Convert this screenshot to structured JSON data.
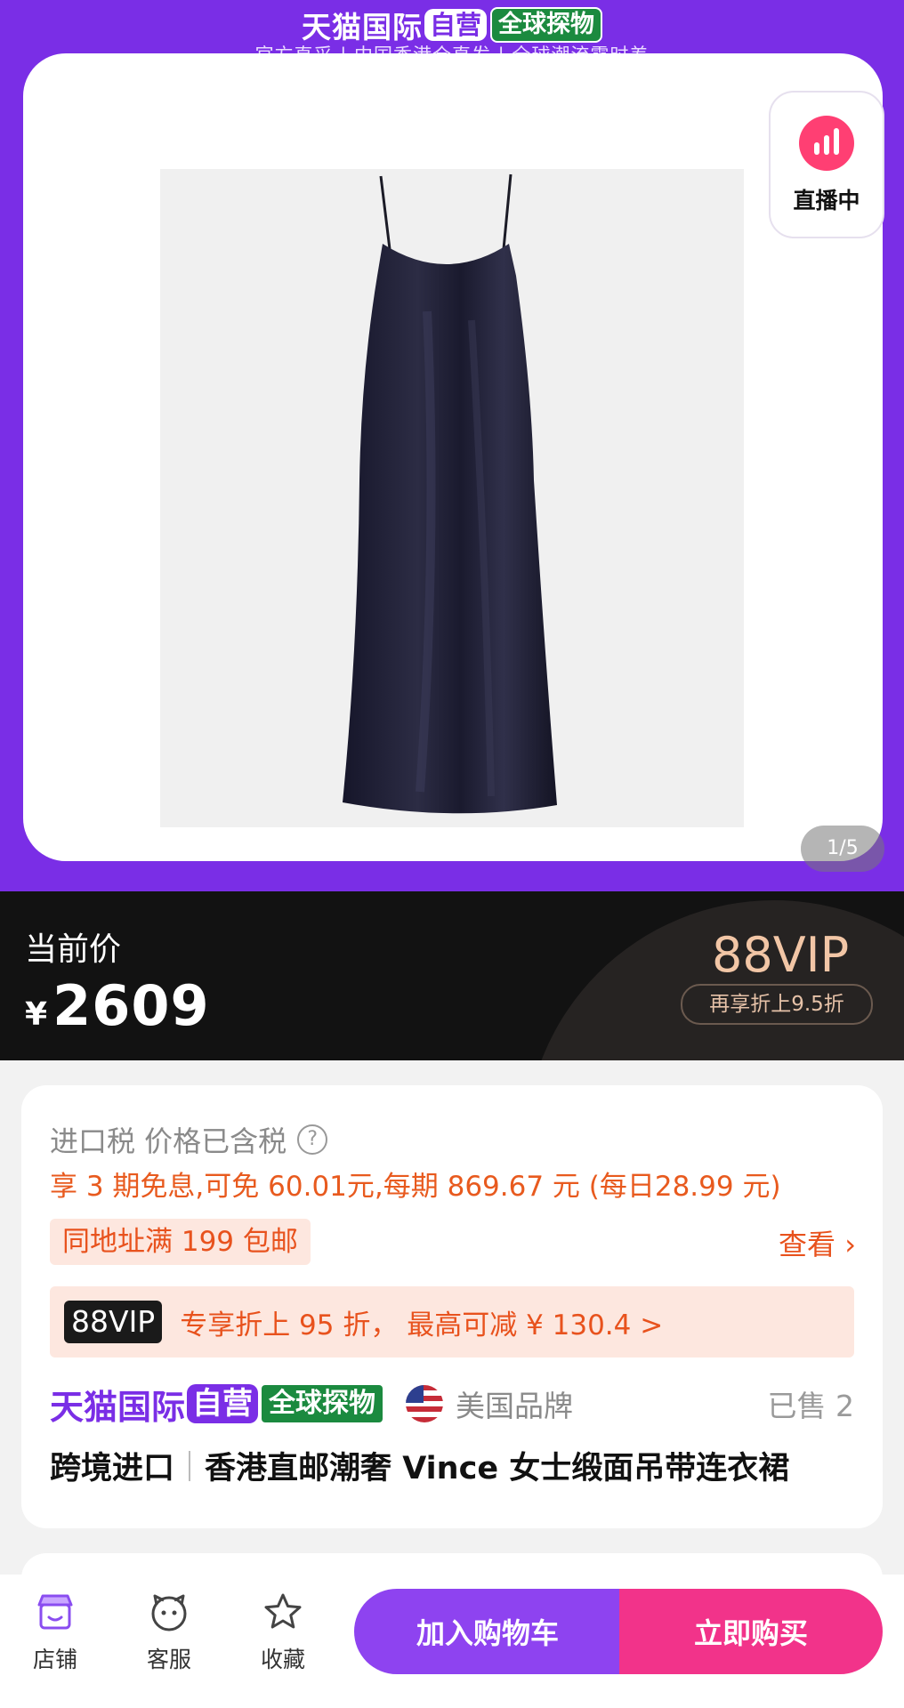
{
  "header": {
    "brand_tmall": "天猫国际",
    "brand_self": "自营",
    "brand_global": "全球探物",
    "slogan": "官方直采 | 中国香港仓直发 | 全球潮流零时差"
  },
  "gallery": {
    "live_label": "直播中",
    "page_indicator": "1/5",
    "current_index": 1,
    "total": 5
  },
  "price": {
    "label": "当前价",
    "currency": "¥",
    "amount": "2609",
    "vip_title": "88VIP",
    "vip_sub": "再享折上9.5折"
  },
  "info": {
    "tax": "进口税 价格已含税",
    "installment": "享 3 期免息,可免 60.01元,每期 869.67 元 (每日28.99 元)",
    "shipping": "同地址满 199 包邮",
    "view_link": "查看 ›",
    "vip_chip": "88VIP",
    "vip_promo": "专享折上 95 折，  最高可减 ¥ 130.4 >",
    "brand_tmall": "天猫国际",
    "brand_self": "自营",
    "brand_global": "全球探物",
    "brand_origin": "美国品牌",
    "sold": "已售 2",
    "title_tag": "跨境进口",
    "title": "香港直邮潮奢 Vince 女士缎面吊带连衣裙"
  },
  "bottom_bar": {
    "store": "店铺",
    "service": "客服",
    "favorite": "收藏",
    "add_to_cart": "加入购物车",
    "buy_now": "立即购买"
  },
  "colors": {
    "brand_purple": "#7a2ee6",
    "promo_orange": "#e8521d",
    "buy_pink": "#f2338a",
    "vip_gold": "#f2c6a6"
  }
}
